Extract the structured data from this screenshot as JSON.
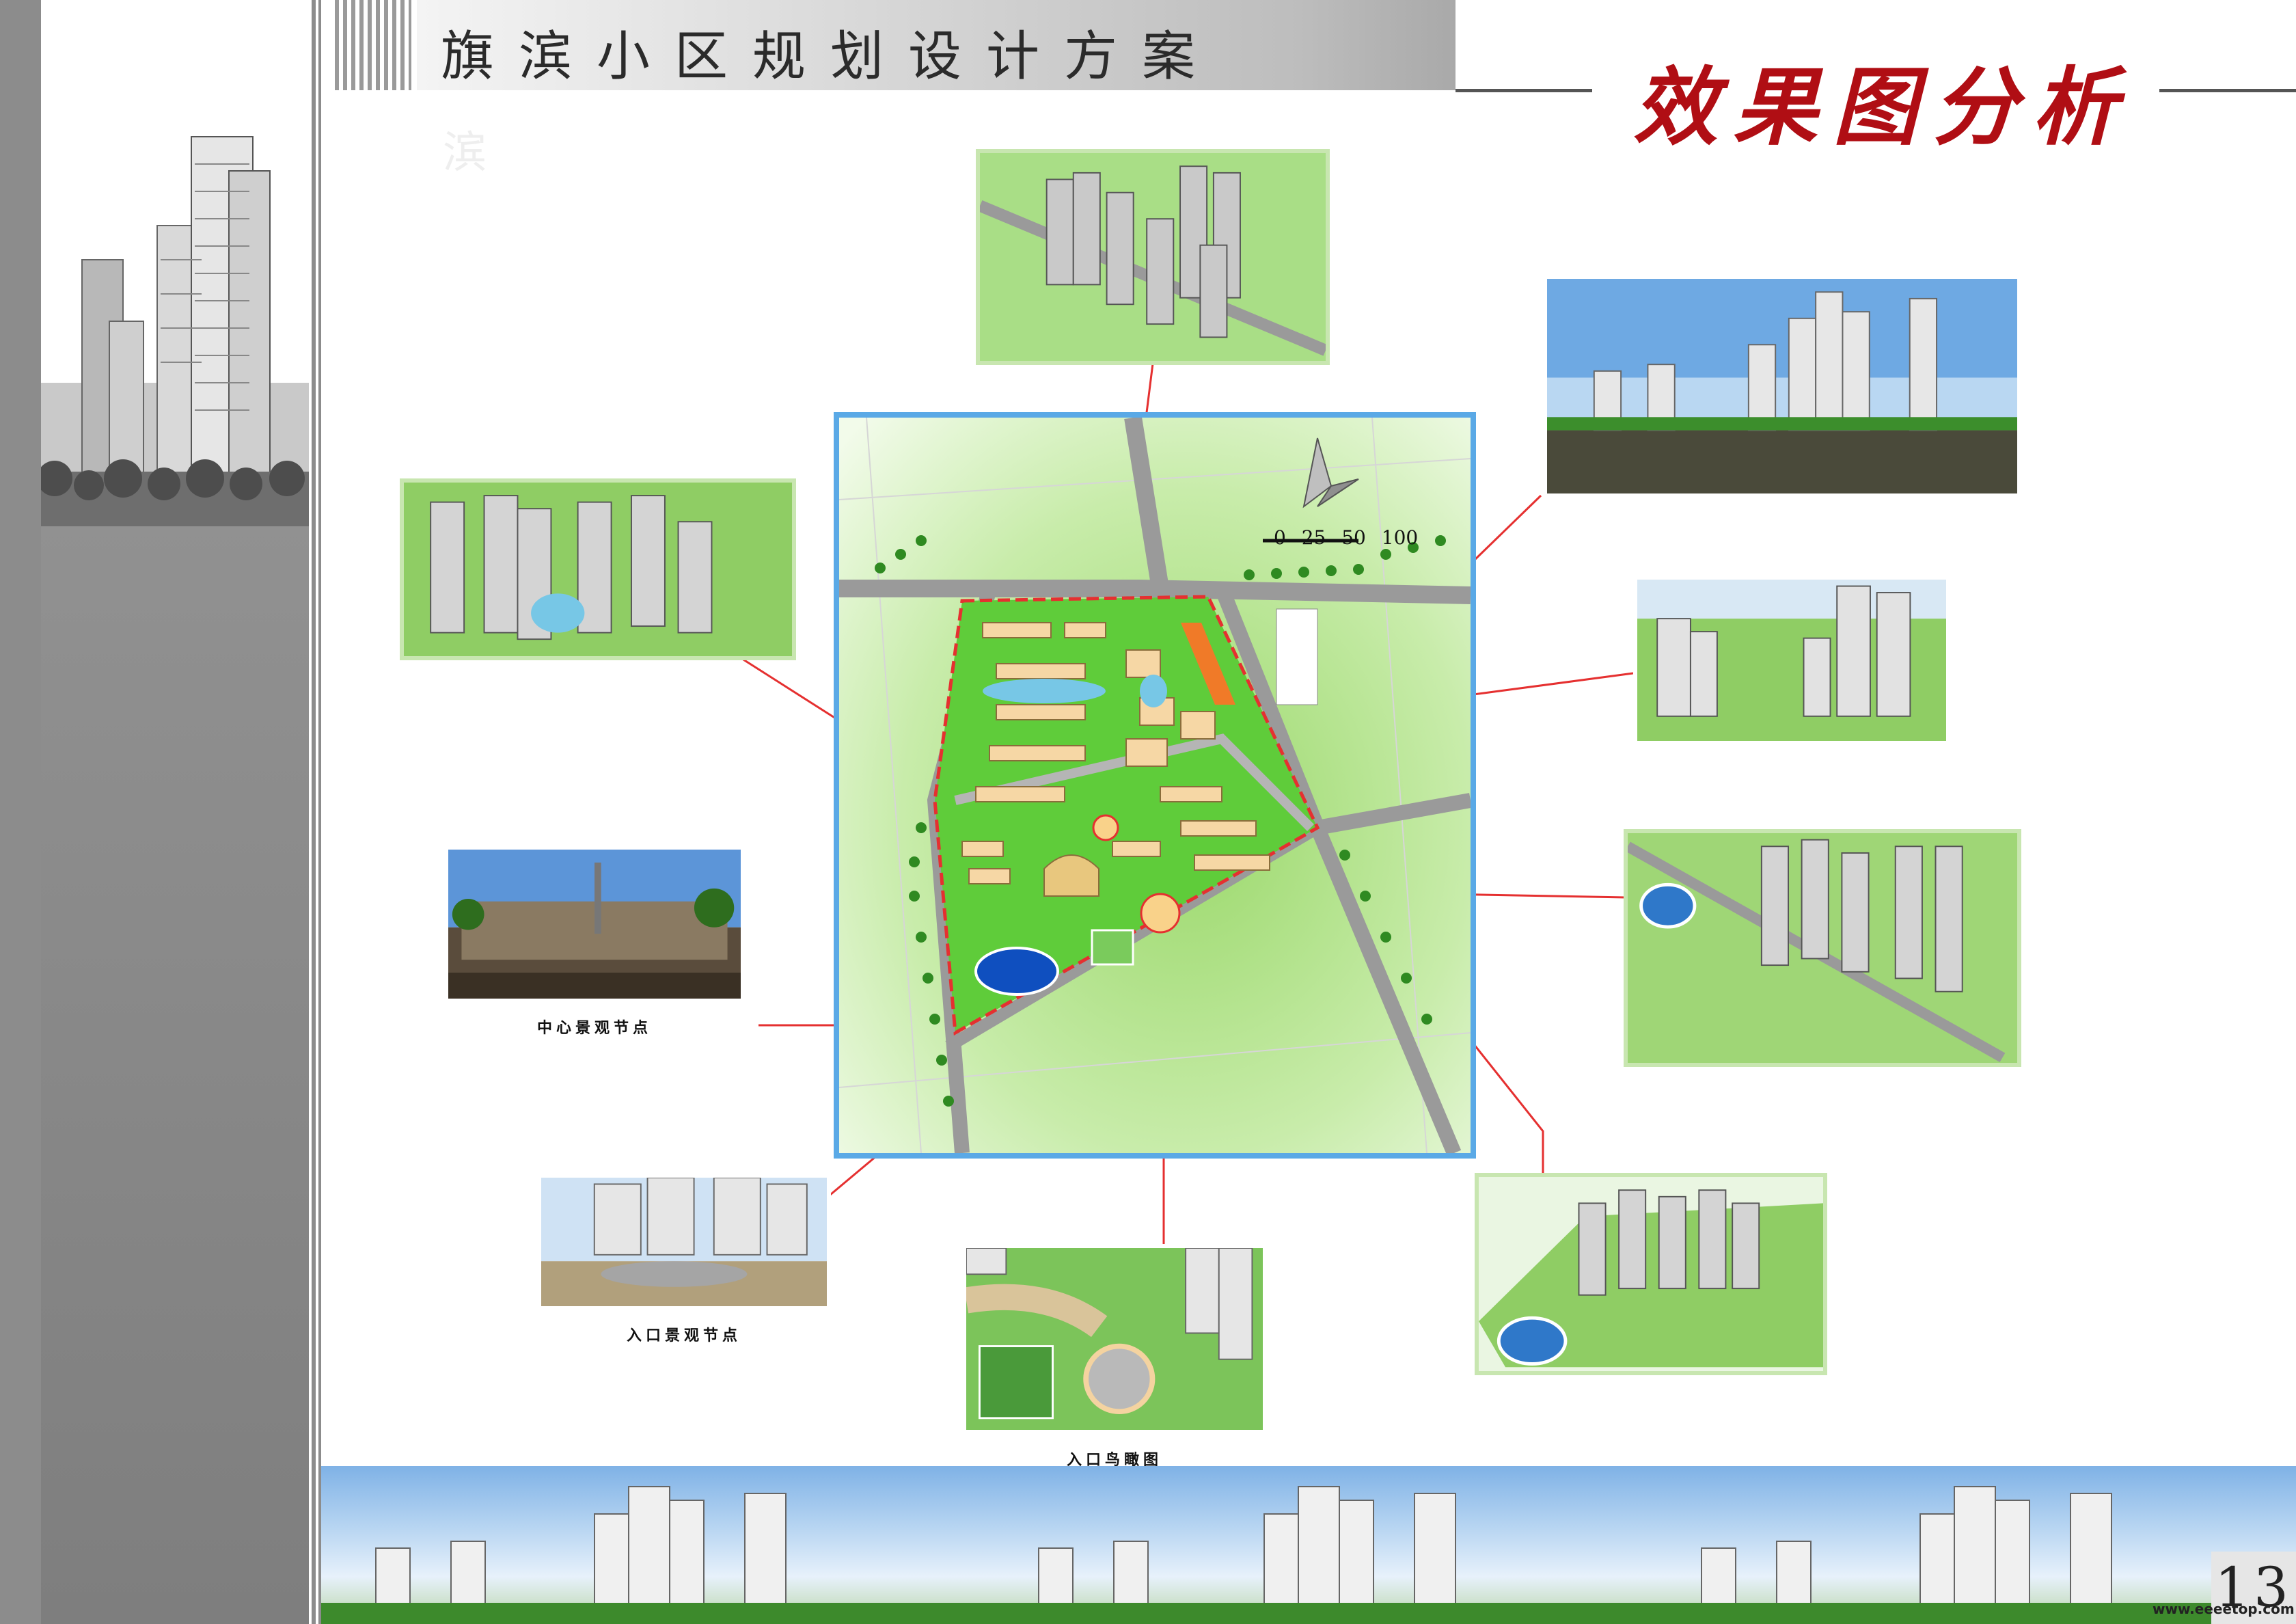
{
  "header": {
    "title": "旗滨小区规划设计方案",
    "ghost_char": "滨",
    "section_title": "效果图分析"
  },
  "plan": {
    "scale": "0 25 50 100"
  },
  "captions": {
    "center_landscape": "中心景观节点",
    "entrance_landscape": "入口景观节点",
    "entrance_aerial": "入口鸟瞰图"
  },
  "footer": {
    "page_number": "13",
    "watermark": "www.eeeetop.com"
  },
  "colors": {
    "accent_red": "#b00e14",
    "plan_border": "#5aa9e6",
    "thumb_border": "#c8e6b0",
    "connector": "#e53030"
  }
}
